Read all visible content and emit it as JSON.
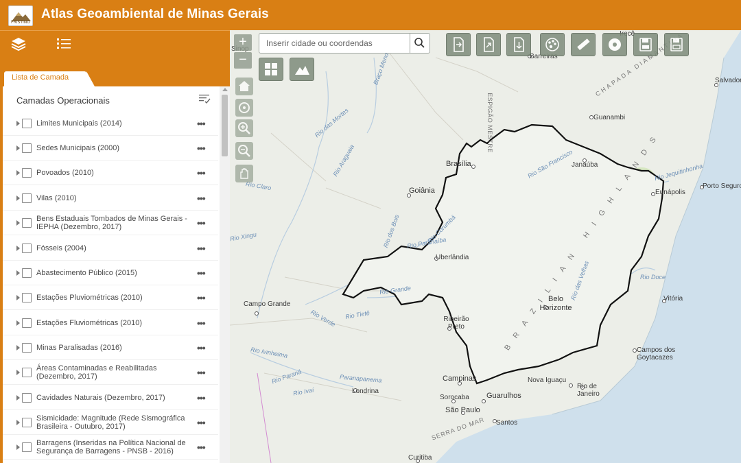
{
  "header": {
    "title": "Atlas Geoambiental de Minas Gerais",
    "logo_text": "PRISTINO"
  },
  "panel": {
    "tab_label": "Lista de Camada",
    "title": "Camadas Operacionais",
    "layers": [
      "Limites Municipais (2014)",
      "Sedes Municipais (2000)",
      "Povoados (2010)",
      "Vilas (2010)",
      "Bens Estaduais Tombados de Minas Gerais - IEPHA (Dezembro, 2017)",
      "Fósseis (2004)",
      "Abastecimento Público (2015)",
      "Estações Pluviométricas (2010)",
      "Estações Fluviométricas (2010)",
      "Minas Paralisadas (2016)",
      "Áreas Contaminadas e Reabilitadas (Dezembro, 2017)",
      "Cavidades Naturais (Dezembro, 2017)",
      "Sismicidade: Magnitude (Rede Sismográfica Brasileira - Outubro, 2017)",
      "Barragens (Inseridas na Política Nacional de Segurança de Barragens - PNSB - 2016)"
    ],
    "more_label": "•••"
  },
  "search": {
    "placeholder": "Inserir cidade ou coordendas"
  },
  "map": {
    "cities": [
      {
        "name": "Brasília"
      },
      {
        "name": "Goiânia"
      },
      {
        "name": "Uberlândia"
      },
      {
        "name": "Belo Horizonte"
      },
      {
        "name": "Campo Grande"
      },
      {
        "name": "Ribeirão Preto"
      },
      {
        "name": "Campinas"
      },
      {
        "name": "Sorocaba"
      },
      {
        "name": "São Paulo"
      },
      {
        "name": "Guarulhos"
      },
      {
        "name": "Rio de Janeiro"
      },
      {
        "name": "Vitória"
      },
      {
        "name": "Londrina"
      },
      {
        "name": "Curitiba"
      },
      {
        "name": "Santos"
      },
      {
        "name": "Nova Iguaçu"
      },
      {
        "name": "Campos dos Goytacazes"
      },
      {
        "name": "Janaúba"
      },
      {
        "name": "Guanambi"
      },
      {
        "name": "Barreiras"
      },
      {
        "name": "Eunápolis"
      },
      {
        "name": "Porto Seguro"
      },
      {
        "name": "Salvador"
      },
      {
        "name": "Sinop"
      },
      {
        "name": "Irecê"
      }
    ],
    "rivers": [
      {
        "name": "Rio das Mortes"
      },
      {
        "name": "Rio Araguaia"
      },
      {
        "name": "Rio Corumbá"
      },
      {
        "name": "Rio Paranaíba"
      },
      {
        "name": "Rio Grande"
      },
      {
        "name": "Rio Tietê"
      },
      {
        "name": "Rio Verde"
      },
      {
        "name": "Rio Ivinheima"
      },
      {
        "name": "Rio Paraná"
      },
      {
        "name": "Paranapanema"
      },
      {
        "name": "Rio Ivaí"
      },
      {
        "name": "Rio São Francisco"
      },
      {
        "name": "Rio das Velhas"
      },
      {
        "name": "Rio Jequitinhonha"
      },
      {
        "name": "Rio Doce"
      },
      {
        "name": "Rio dos Bois"
      },
      {
        "name": "Rio Claro"
      },
      {
        "name": "Rio Xingu"
      },
      {
        "name": "Braço Menor"
      }
    ],
    "regions": [
      {
        "name": "BRAZILIAN HIGHLANDS"
      },
      {
        "name": "ESPIGÃO MESTRE"
      },
      {
        "name": "CHAPADA DIAMANTINA"
      },
      {
        "name": "SERRA DO MAR"
      }
    ]
  }
}
